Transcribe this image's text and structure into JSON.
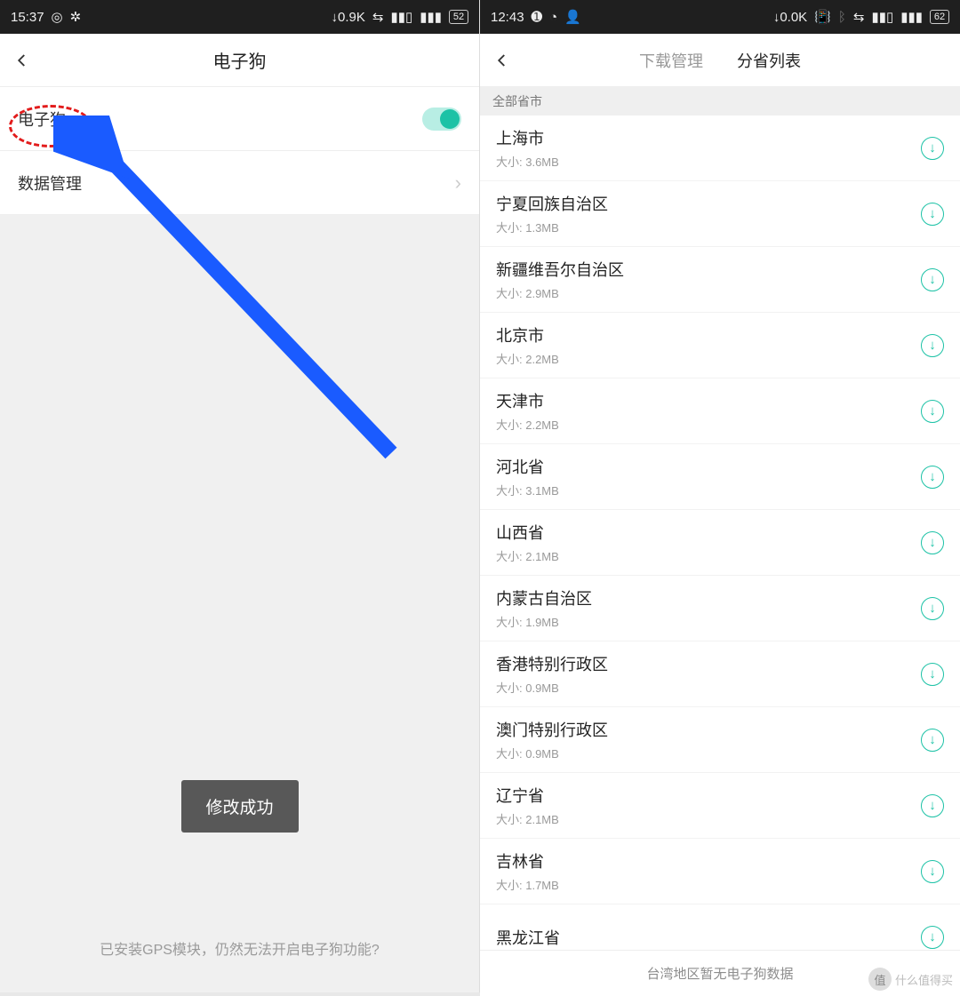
{
  "left": {
    "status": {
      "time": "15:37",
      "net": "↓0.9K",
      "battery": "52"
    },
    "title": "电子狗",
    "row_toggle_label": "电子狗",
    "row_data_label": "数据管理",
    "toast": "修改成功",
    "footer_hint": "已安装GPS模块，仍然无法开启电子狗功能?"
  },
  "right": {
    "status": {
      "time": "12:43",
      "net": "↓0.0K",
      "battery": "62"
    },
    "tab_downloads": "下载管理",
    "tab_provinces": "分省列表",
    "section_header": "全部省市",
    "size_prefix": "大小: ",
    "provinces": [
      {
        "name": "上海市",
        "size": "3.6MB"
      },
      {
        "name": "宁夏回族自治区",
        "size": "1.3MB"
      },
      {
        "name": "新疆维吾尔自治区",
        "size": "2.9MB"
      },
      {
        "name": "北京市",
        "size": "2.2MB"
      },
      {
        "name": "天津市",
        "size": "2.2MB"
      },
      {
        "name": "河北省",
        "size": "3.1MB"
      },
      {
        "name": "山西省",
        "size": "2.1MB"
      },
      {
        "name": "内蒙古自治区",
        "size": "1.9MB"
      },
      {
        "name": "香港特别行政区",
        "size": "0.9MB"
      },
      {
        "name": "澳门特别行政区",
        "size": "0.9MB"
      },
      {
        "name": "辽宁省",
        "size": "2.1MB"
      },
      {
        "name": "吉林省",
        "size": "1.7MB"
      },
      {
        "name": "黑龙江省",
        "size": ""
      }
    ],
    "bottom_note": "台湾地区暂无电子狗数据",
    "watermark": "什么值得买",
    "watermark_badge": "值"
  }
}
